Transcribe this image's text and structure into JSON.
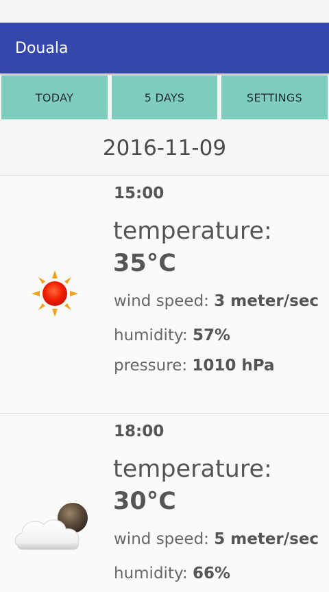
{
  "app": {
    "title": "Douala"
  },
  "tabs": [
    {
      "label": "TODAY"
    },
    {
      "label": "5 DAYS"
    },
    {
      "label": "SETTINGS"
    }
  ],
  "date": "2016-11-09",
  "forecasts": [
    {
      "time": "15:00",
      "icon": "sun-icon",
      "temperature_label": "temperature:",
      "temperature": "35°C",
      "wind_label": "wind speed:",
      "wind": "3 meter/sec",
      "humidity_label": "humidity:",
      "humidity": "57%",
      "pressure_label": "pressure:",
      "pressure": "1010 hPa"
    },
    {
      "time": "18:00",
      "icon": "cloud-moon-icon",
      "temperature_label": "temperature:",
      "temperature": "30°C",
      "wind_label": "wind speed:",
      "wind": "5 meter/sec",
      "humidity_label": "humidity:",
      "humidity": "66%"
    }
  ],
  "colors": {
    "app_bar": "#3547ad",
    "tab_background": "#7fcdbd"
  }
}
